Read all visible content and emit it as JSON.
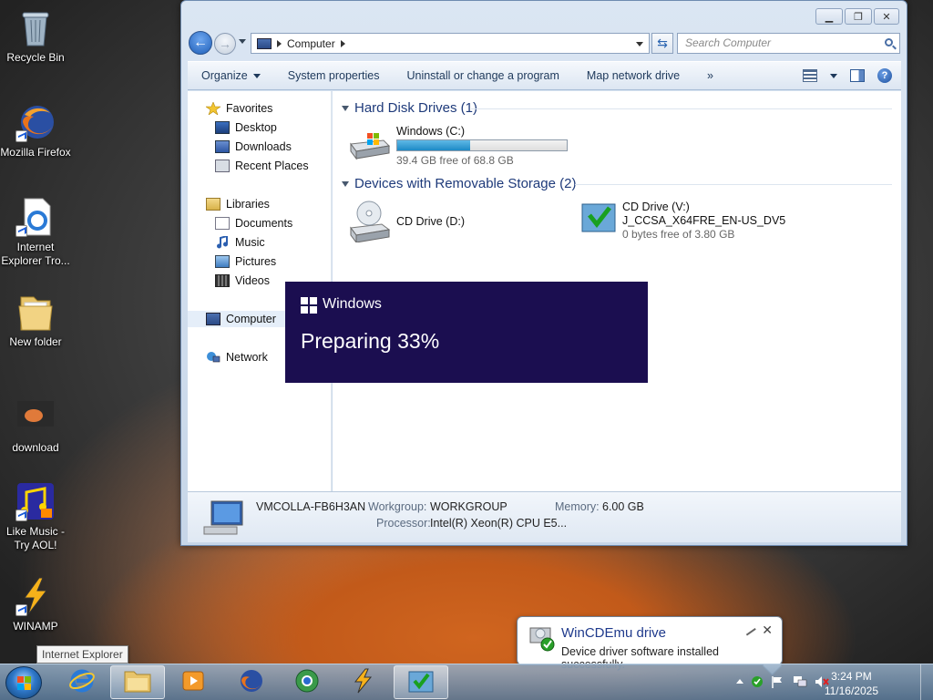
{
  "desktop": {
    "icons": [
      {
        "label": "Recycle Bin"
      },
      {
        "label": "Mozilla Firefox"
      },
      {
        "label": "Internet Explorer Tro..."
      },
      {
        "label": "New folder"
      },
      {
        "label": "download"
      },
      {
        "label": "Like Music - Try AOL!"
      },
      {
        "label": "WINAMP"
      }
    ]
  },
  "window": {
    "breadcrumb": "Computer",
    "search_placeholder": "Search Computer",
    "toolbar": {
      "organize": "Organize",
      "system_properties": "System properties",
      "uninstall": "Uninstall or change a program",
      "map_drive": "Map network drive",
      "more": "»"
    },
    "nav": {
      "favorites": "Favorites",
      "desktop": "Desktop",
      "downloads": "Downloads",
      "recent": "Recent Places",
      "libraries": "Libraries",
      "documents": "Documents",
      "music": "Music",
      "pictures": "Pictures",
      "videos": "Videos",
      "computer": "Computer",
      "network": "Network"
    },
    "groups": {
      "hdd_header": "Hard Disk Drives (1)",
      "removable_header": "Devices with Removable Storage (2)"
    },
    "drives": {
      "c": {
        "name": "Windows (C:)",
        "free": "39.4 GB free of 68.8 GB",
        "used_fraction": 0.43
      },
      "d": {
        "name": "CD Drive (D:)"
      },
      "v": {
        "name": "CD Drive (V:)",
        "label": "J_CCSA_X64FRE_EN-US_DV5",
        "free": "0 bytes free of 3.80 GB"
      }
    },
    "details": {
      "computer_name": "VMCOLLA-FB6H3AN",
      "workgroup_label": "Workgroup:",
      "workgroup": "WORKGROUP",
      "memory_label": "Memory:",
      "memory": "6.00 GB",
      "processor_label": "Processor:",
      "processor": "Intel(R) Xeon(R) CPU E5..."
    }
  },
  "overlay": {
    "brand": "Windows",
    "progress_text": "Preparing 33%"
  },
  "notification": {
    "title": "WinCDEmu drive",
    "message": "Device driver software installed successfully.",
    "close": "✕"
  },
  "tooltip": "Internet Explorer",
  "clock": {
    "time": "3:24 PM",
    "date": "11/16/2025"
  },
  "colors": {
    "accent": "#1b0e50",
    "progress": "#1d8ac6"
  }
}
